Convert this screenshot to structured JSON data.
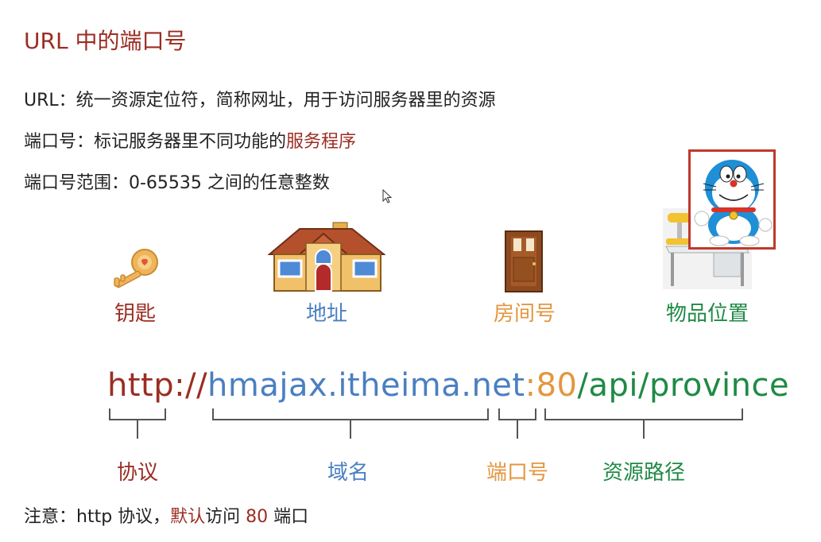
{
  "title": "URL 中的端口号",
  "lines": {
    "url_def": "URL：统一资源定位符，简称网址，用于访问服务器里的资源",
    "port_def_prefix": "端口号：标记服务器里不同功能的",
    "port_def_highlight": "服务程序",
    "port_range": "端口号范围：0-65535 之间的任意整数"
  },
  "analogy": [
    {
      "label": "钥匙",
      "icon": "key-icon",
      "color": "#9b2d23"
    },
    {
      "label": "地址",
      "icon": "house-icon",
      "color": "#4a7fc1"
    },
    {
      "label": "房间号",
      "icon": "door-icon",
      "color": "#e4963f"
    },
    {
      "label": "物品位置",
      "icon": "desk-icon",
      "color": "#1f8a45"
    }
  ],
  "url": {
    "protocol": "http://",
    "domain": "hmajax.itheima.net",
    "port": ":80",
    "path": "/api/province"
  },
  "parts": {
    "protocol": "协议",
    "domain": "域名",
    "port": "端口号",
    "path": "资源路径"
  },
  "note": {
    "prefix": "注意：http 协议，",
    "highlight1": "默认",
    "middle": "访问 ",
    "highlight2": "80",
    "suffix": " 端口"
  },
  "colors": {
    "protocol": "#9b2d23",
    "domain": "#4a7fc1",
    "port": "#e4963f",
    "path": "#1f8a45"
  }
}
